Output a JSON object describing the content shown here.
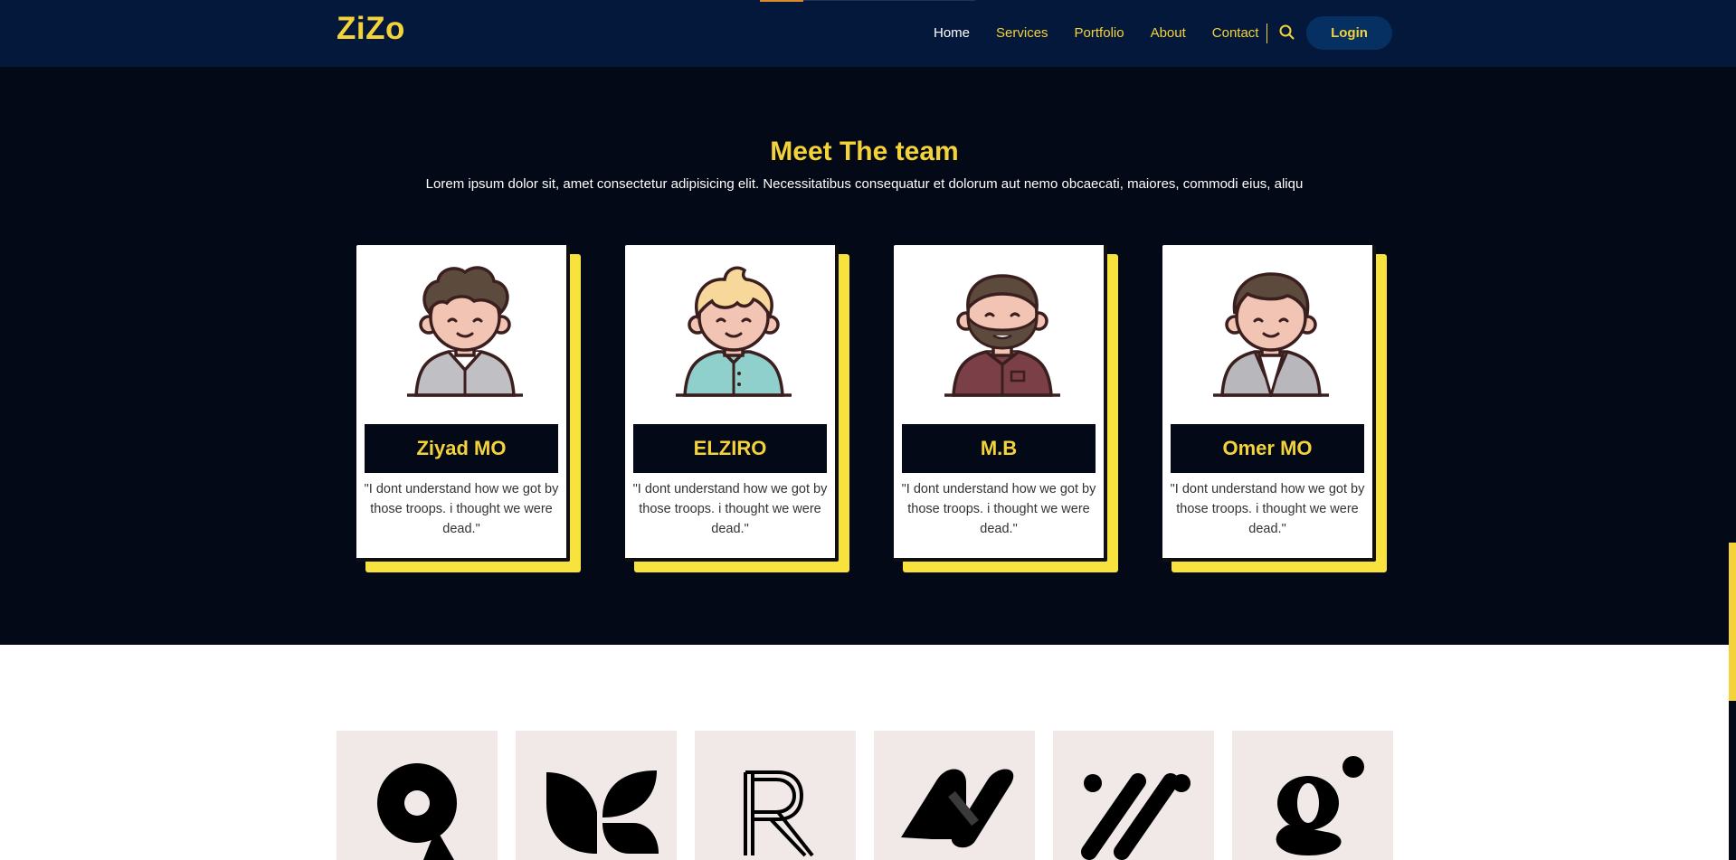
{
  "brand": {
    "name": "ZiZo",
    "accent_color": "#f4d33a",
    "header_bg": "#03183a",
    "section_bg": "#030916"
  },
  "nav": {
    "items": [
      {
        "label": "Home",
        "active": true
      },
      {
        "label": "Services",
        "active": false
      },
      {
        "label": "Portfolio",
        "active": false
      },
      {
        "label": "About",
        "active": false
      },
      {
        "label": "Contact",
        "active": false
      }
    ],
    "search_icon": "search-icon",
    "login_label": "Login"
  },
  "team": {
    "title": "Meet The team",
    "subtitle": "Lorem ipsum dolor sit, amet consectetur adipisicing elit. Necessitatibus consequatur et dolorum aut nemo obcaecati, maiores, commodi eius, aliqu",
    "members": [
      {
        "name": "Ziyad MO",
        "quote": "\"I dont understand how we got by those troops. i thought we were dead.\"",
        "avatar": "curly-hair-avatar-icon"
      },
      {
        "name": "ELZIRO",
        "quote": "\"I dont understand how we got by those troops. i thought we were dead.\"",
        "avatar": "blonde-hair-avatar-icon"
      },
      {
        "name": "M.B",
        "quote": "\"I dont understand how we got by those troops. i thought we were dead.\"",
        "avatar": "bearded-avatar-icon"
      },
      {
        "name": "Omer MO",
        "quote": "\"I dont understand how we got by those troops. i thought we were dead.\"",
        "avatar": "suit-avatar-icon"
      }
    ]
  },
  "brands": {
    "logos": [
      "nine-logo-icon",
      "k-leaf-logo-icon",
      "r-outline-logo-icon",
      "n-stripe-logo-icon",
      "dots-slashes-logo-icon",
      "g-serif-logo-icon"
    ]
  }
}
